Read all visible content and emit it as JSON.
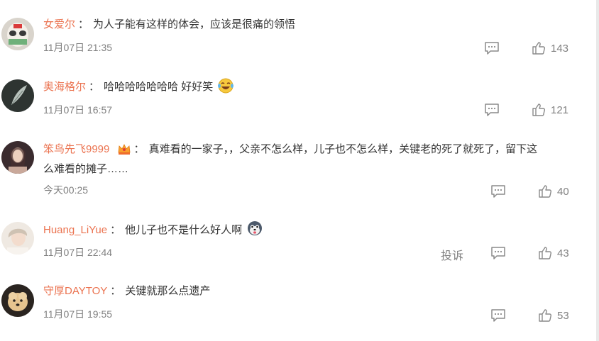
{
  "comments": [
    {
      "username": "女爱尔",
      "text": "为人子能有这样的体会，应该是很痛的领悟",
      "time": "11月07日 21:35",
      "likes": "143",
      "avatar_icon": "avatar-panda-mask"
    },
    {
      "username": "奥海格尔",
      "text": "哈哈哈哈哈哈哈 好好笑",
      "time": "11月07日 16:57",
      "likes": "121",
      "emoji": "laugh-cry-emoji",
      "avatar_icon": "avatar-feather"
    },
    {
      "username": "笨鸟先飞9999",
      "text_line1": "真难看的一家子，，父亲不怎么样，儿子也不怎么样，关键老的死了就死了，留下这",
      "text_line2": "么难看的摊子……",
      "time": "今天00:25",
      "likes": "40",
      "badge": "crown-badge",
      "avatar_icon": "avatar-woman-photo"
    },
    {
      "username": "Huang_LiYue",
      "text": "他儿子也不是什么好人啊",
      "time": "11月07日 22:44",
      "likes": "43",
      "report_label": "投诉",
      "emoji": "husky-emoji",
      "avatar_icon": "avatar-person-photo"
    },
    {
      "username": "守厚DAYTOY",
      "text": "关键就那么点遗产",
      "time": "11月07日 19:55",
      "likes": "53",
      "avatar_icon": "avatar-dog-photo"
    }
  ],
  "colors": {
    "username": "#eb7350",
    "text": "#333333",
    "meta": "#808080"
  },
  "icons": {
    "reply": "comment-icon",
    "like": "thumbs-up-icon"
  }
}
